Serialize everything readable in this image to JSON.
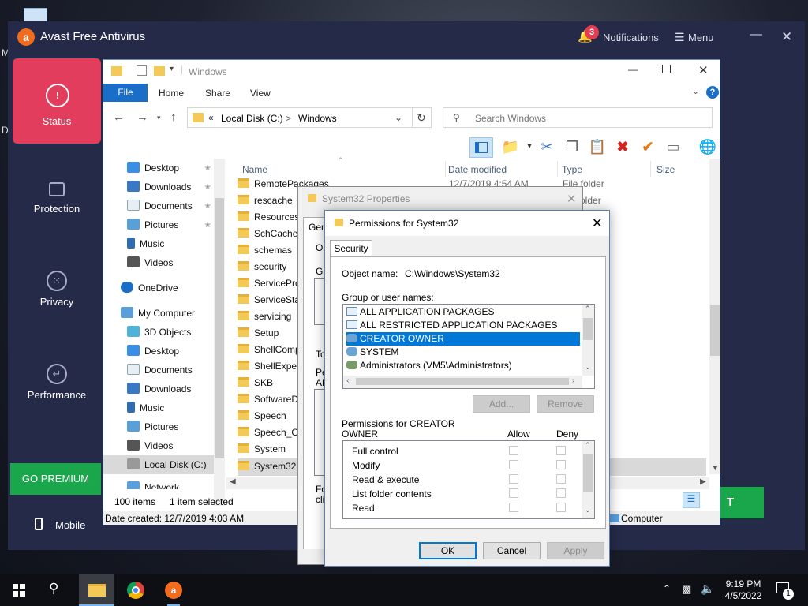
{
  "desktop": {
    "stray_letters": [
      "M",
      "D"
    ]
  },
  "avast": {
    "app_title": "Avast Free Antivirus",
    "notifications": {
      "count": "3",
      "label": "Notifications"
    },
    "menu_label": "Menu",
    "nav": [
      {
        "label": "Status",
        "icon": "alert-icon"
      },
      {
        "label": "Protection",
        "icon": "lock-icon"
      },
      {
        "label": "Privacy",
        "icon": "fingerprint-icon"
      },
      {
        "label": "Performance",
        "icon": "gauge-icon"
      }
    ],
    "go_premium": "GO PREMIUM",
    "mobile": "Mobile",
    "partial_button_text": "T",
    "colors": {
      "bg": "#252a48",
      "status": "#e23d5c",
      "premium": "#1aa64b",
      "logo": "#f26c1e"
    }
  },
  "explorer": {
    "title": "Windows",
    "tabs": [
      "File",
      "Home",
      "Share",
      "View"
    ],
    "address": {
      "crumbs": [
        "Local Disk (C:)",
        "Windows"
      ],
      "separator": ">",
      "chevron": "«"
    },
    "search_placeholder": "Search Windows",
    "sidebar": [
      {
        "label": "Desktop",
        "icon": "desktop-icon",
        "pinned": true
      },
      {
        "label": "Downloads",
        "icon": "download-icon",
        "pinned": true
      },
      {
        "label": "Documents",
        "icon": "document-icon",
        "pinned": true
      },
      {
        "label": "Pictures",
        "icon": "pictures-icon",
        "pinned": true
      },
      {
        "label": "Music",
        "icon": "music-icon",
        "pinned": false
      },
      {
        "label": "Videos",
        "icon": "video-icon",
        "pinned": false
      },
      {
        "label": "OneDrive",
        "icon": "cloud-icon",
        "pinned": false
      },
      {
        "label": "My Computer",
        "icon": "computer-icon",
        "pinned": false
      },
      {
        "label": "3D Objects",
        "icon": "cube-icon",
        "pinned": false
      },
      {
        "label": "Desktop",
        "icon": "desktop-icon",
        "pinned": false
      },
      {
        "label": "Documents",
        "icon": "document-icon",
        "pinned": false
      },
      {
        "label": "Downloads",
        "icon": "download-icon",
        "pinned": false
      },
      {
        "label": "Music",
        "icon": "music-icon",
        "pinned": false
      },
      {
        "label": "Pictures",
        "icon": "pictures-icon",
        "pinned": false
      },
      {
        "label": "Videos",
        "icon": "video-icon",
        "pinned": false
      },
      {
        "label": "Local Disk (C:)",
        "icon": "drive-icon",
        "pinned": false,
        "selected": true
      },
      {
        "label": "Network",
        "icon": "network-icon",
        "pinned": false
      }
    ],
    "columns": [
      "Name",
      "Date modified",
      "Type",
      "Size"
    ],
    "rows": [
      {
        "name": "RemotePackages",
        "date": "12/7/2019 4:54 AM",
        "type": "File folder"
      },
      {
        "name": "rescache",
        "date": "",
        "type": "older"
      },
      {
        "name": "Resources",
        "date": "",
        "type": ""
      },
      {
        "name": "SchCache",
        "date": "",
        "type": ""
      },
      {
        "name": "schemas",
        "date": "",
        "type": ""
      },
      {
        "name": "security",
        "date": "",
        "type": ""
      },
      {
        "name": "ServiceProfiles",
        "date": "",
        "type": ""
      },
      {
        "name": "ServiceState",
        "date": "",
        "type": ""
      },
      {
        "name": "servicing",
        "date": "",
        "type": ""
      },
      {
        "name": "Setup",
        "date": "",
        "type": ""
      },
      {
        "name": "ShellComponents",
        "date": "",
        "type": ""
      },
      {
        "name": "ShellExperiences",
        "date": "",
        "type": ""
      },
      {
        "name": "SKB",
        "date": "",
        "type": ""
      },
      {
        "name": "SoftwareDistribution",
        "date": "",
        "type": ""
      },
      {
        "name": "Speech",
        "date": "",
        "type": ""
      },
      {
        "name": "Speech_OneCore",
        "date": "",
        "type": ""
      },
      {
        "name": "System",
        "date": "",
        "type": ""
      },
      {
        "name": "System32",
        "date": "",
        "type": "",
        "selected": true
      }
    ],
    "status": {
      "count": "100 items",
      "selected": "1 item selected"
    },
    "details": {
      "created": "Date created: 12/7/2019 4:03 AM",
      "computer": "Computer"
    }
  },
  "properties": {
    "title": "System32 Properties",
    "tab_fragment": "Gen",
    "frag_obj": "Ob",
    "frag_grp": "Gro",
    "frag_to": "To",
    "frag_pe": "Pe",
    "frag_ap": "AP",
    "frag_fo": "Fo",
    "frag_cl": "clic"
  },
  "permissions": {
    "title": "Permissions for System32",
    "tab": "Security",
    "object_label": "Object name:",
    "object_value": "C:\\Windows\\System32",
    "group_label": "Group or user names:",
    "groups": [
      {
        "name": "ALL APPLICATION PACKAGES"
      },
      {
        "name": "ALL RESTRICTED APPLICATION PACKAGES"
      },
      {
        "name": "CREATOR OWNER",
        "selected": true
      },
      {
        "name": "SYSTEM"
      },
      {
        "name": "Administrators (VM5\\Administrators)"
      }
    ],
    "add_button": "Add...",
    "remove_button": "Remove",
    "perms_label_1": "Permissions for CREATOR",
    "perms_label_2": "OWNER",
    "allow": "Allow",
    "deny": "Deny",
    "perms": [
      "Full control",
      "Modify",
      "Read & execute",
      "List folder contents",
      "Read"
    ],
    "ok": "OK",
    "cancel": "Cancel",
    "apply": "Apply"
  },
  "taskbar": {
    "time": "9:19 PM",
    "date": "4/5/2022",
    "notif_count": "1"
  }
}
